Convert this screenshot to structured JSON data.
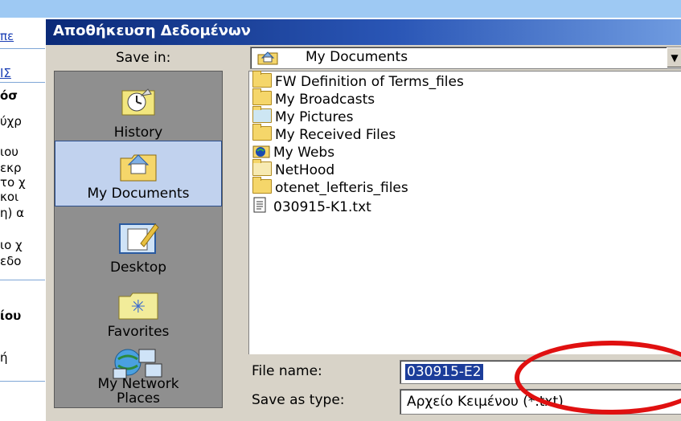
{
  "dialog": {
    "title": "Αποθήκευση Δεδομένων",
    "save_in_label": "Save in:",
    "save_in_value": "My Documents",
    "file_name_label": "File name:",
    "file_name_value": "030915-E2",
    "save_as_type_label": "Save as type:",
    "save_as_type_value": "Αρχείο Κειμένου (*.txt)"
  },
  "places": [
    {
      "label": "History",
      "icon": "history-icon"
    },
    {
      "label": "My Documents",
      "icon": "my-documents-icon",
      "selected": true
    },
    {
      "label": "Desktop",
      "icon": "desktop-icon"
    },
    {
      "label": "Favorites",
      "icon": "favorites-icon"
    },
    {
      "label": "My Network Places",
      "icon": "network-places-icon"
    }
  ],
  "files": [
    {
      "name": "FW Definition of Terms_files",
      "icon": "folder-icon"
    },
    {
      "name": "My Broadcasts",
      "icon": "folder-icon"
    },
    {
      "name": "My Pictures",
      "icon": "pictures-folder-icon"
    },
    {
      "name": "My Received Files",
      "icon": "folder-icon"
    },
    {
      "name": "My Webs",
      "icon": "webs-folder-icon"
    },
    {
      "name": "NetHood",
      "icon": "folder-icon"
    },
    {
      "name": "otenet_lefteris_files",
      "icon": "folder-icon"
    },
    {
      "name": "030915-K1.txt",
      "icon": "text-file-icon"
    }
  ],
  "background_page": {
    "fragments": [
      "πε",
      "ΙΣ",
      "όσ",
      "ύχρ",
      "ιου",
      "εκρ",
      "το χ",
      "κοι",
      "η) α",
      "ιο χ",
      "εδο",
      "ίου",
      "ή"
    ]
  },
  "colors": {
    "annotation_circle": "#e01010",
    "title_bar": "#0b2a78",
    "selection": "#1c3d9a"
  }
}
